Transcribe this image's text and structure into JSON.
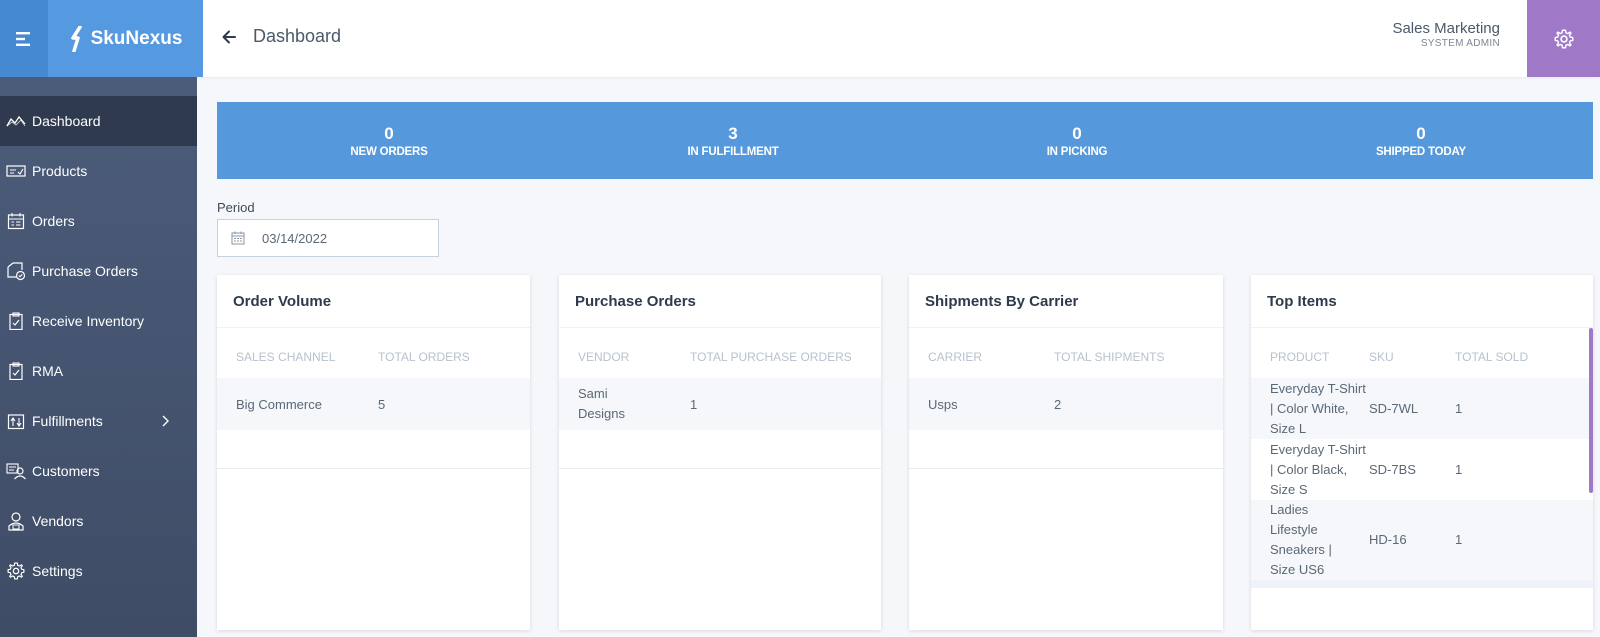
{
  "header": {
    "brand": "SkuNexus",
    "page_title": "Dashboard",
    "user_name": "Sales Marketing",
    "user_role": "SYSTEM ADMIN",
    "accent_color": "#5599dc",
    "settings_color": "#a078c8"
  },
  "sidebar": {
    "items": [
      {
        "label": "Dashboard",
        "icon": "chart-line-icon",
        "active": true
      },
      {
        "label": "Products",
        "icon": "product-tag-icon"
      },
      {
        "label": "Orders",
        "icon": "calendar-list-icon"
      },
      {
        "label": "Purchase Orders",
        "icon": "purchase-order-icon"
      },
      {
        "label": "Receive Inventory",
        "icon": "clipboard-check-icon"
      },
      {
        "label": "RMA",
        "icon": "clipboard-return-icon"
      },
      {
        "label": "Fulfillments",
        "icon": "fulfillment-icon",
        "has_submenu": true
      },
      {
        "label": "Customers",
        "icon": "customers-icon"
      },
      {
        "label": "Vendors",
        "icon": "vendor-icon"
      },
      {
        "label": "Settings",
        "icon": "gear-icon"
      }
    ]
  },
  "stats": [
    {
      "value": "0",
      "label": "NEW ORDERS"
    },
    {
      "value": "3",
      "label": "IN FULFILLMENT"
    },
    {
      "value": "0",
      "label": "IN PICKING"
    },
    {
      "value": "0",
      "label": "SHIPPED TODAY"
    }
  ],
  "period": {
    "label": "Period",
    "value": "03/14/2022"
  },
  "cards": {
    "order_volume": {
      "title": "Order Volume",
      "headers": [
        "SALES CHANNEL",
        "TOTAL ORDERS"
      ],
      "rows": [
        [
          "Big Commerce",
          "5"
        ]
      ]
    },
    "purchase_orders": {
      "title": "Purchase Orders",
      "headers": [
        "VENDOR",
        "TOTAL PURCHASE ORDERS"
      ],
      "rows": [
        [
          "Sami Designs",
          "1"
        ]
      ]
    },
    "shipments": {
      "title": "Shipments By Carrier",
      "headers": [
        "CARRIER",
        "TOTAL SHIPMENTS"
      ],
      "rows": [
        [
          "Usps",
          "2"
        ]
      ]
    },
    "top_items": {
      "title": "Top Items",
      "headers": [
        "PRODUCT",
        "SKU",
        "TOTAL SOLD"
      ],
      "rows": [
        [
          "Everyday T-Shirt | Color White, Size L",
          "SD-7WL",
          "1"
        ],
        [
          "Everyday T-Shirt | Color Black, Size S",
          "SD-7BS",
          "1"
        ],
        [
          "Ladies Lifestyle Sneakers | Size US6",
          "HD-16",
          "1"
        ]
      ]
    }
  }
}
